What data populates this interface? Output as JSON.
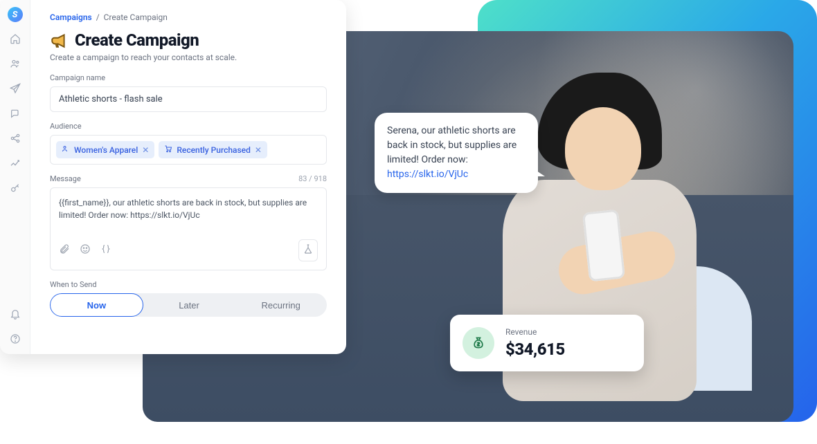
{
  "breadcrumb": {
    "root": "Campaigns",
    "sep": "/",
    "current": "Create Campaign"
  },
  "page": {
    "title": "Create Campaign",
    "subtitle": "Create a campaign to reach your contacts at scale."
  },
  "form": {
    "name_label": "Campaign name",
    "name_value": "Athletic shorts - flash sale",
    "audience_label": "Audience",
    "tags": [
      {
        "icon": "people-icon",
        "label": "Women's Apparel"
      },
      {
        "icon": "cart-icon",
        "label": "Recently Purchased"
      }
    ],
    "message_label": "Message",
    "counter": "83 / 918",
    "message_value": "{{first_name}}, our athletic shorts are back in stock, but supplies are limited! Order now: https://slkt.io/VjUc",
    "when_label": "When to Send",
    "options": [
      {
        "label": "Now",
        "active": true
      },
      {
        "label": "Later",
        "active": false
      },
      {
        "label": "Recurring",
        "active": false
      }
    ]
  },
  "sidebar_icons": [
    "home-icon",
    "people-icon",
    "paper-plane-icon",
    "chat-icon",
    "share-icon",
    "chart-icon",
    "key-icon"
  ],
  "bottom_icons": [
    "bell-icon",
    "help-icon"
  ],
  "speech": {
    "text": "Serena, our athletic shorts are back in stock, but supplies are limited! Order now: ",
    "link_text": "https://slkt.io/VjUc",
    "link_href": "https://slkt.io/VjUc"
  },
  "revenue": {
    "label": "Revenue",
    "amount": "$34,615"
  }
}
